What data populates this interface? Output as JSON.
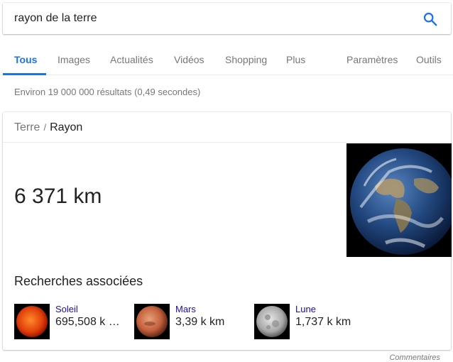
{
  "search": {
    "query": "rayon de la terre",
    "icon": "search-icon",
    "accent_color": "#1a73e8"
  },
  "tabs": [
    {
      "label": "Tous",
      "active": true
    },
    {
      "label": "Images"
    },
    {
      "label": "Actualités"
    },
    {
      "label": "Vidéos"
    },
    {
      "label": "Shopping"
    },
    {
      "label": "Plus"
    },
    {
      "label": "Paramètres"
    },
    {
      "label": "Outils"
    }
  ],
  "result_stats": "Environ 19 000 000 résultats (0,49 secondes)",
  "card": {
    "breadcrumb": {
      "parent": "Terre",
      "separator": "/",
      "current": "Rayon"
    },
    "value": "6 371 km",
    "image": "earth-image",
    "related_title": "Recherches associées",
    "related": [
      {
        "name": "Soleil",
        "value": "695,508 k …",
        "image": "sun-image"
      },
      {
        "name": "Mars",
        "value": "3,39 k km",
        "image": "mars-image"
      },
      {
        "name": "Lune",
        "value": "1,737 k km",
        "image": "moon-image"
      }
    ]
  },
  "feedback": "Commentaires",
  "colors": {
    "link": "#1a0dab",
    "active_tab": "#1a73e8",
    "muted_text": "#777777"
  }
}
